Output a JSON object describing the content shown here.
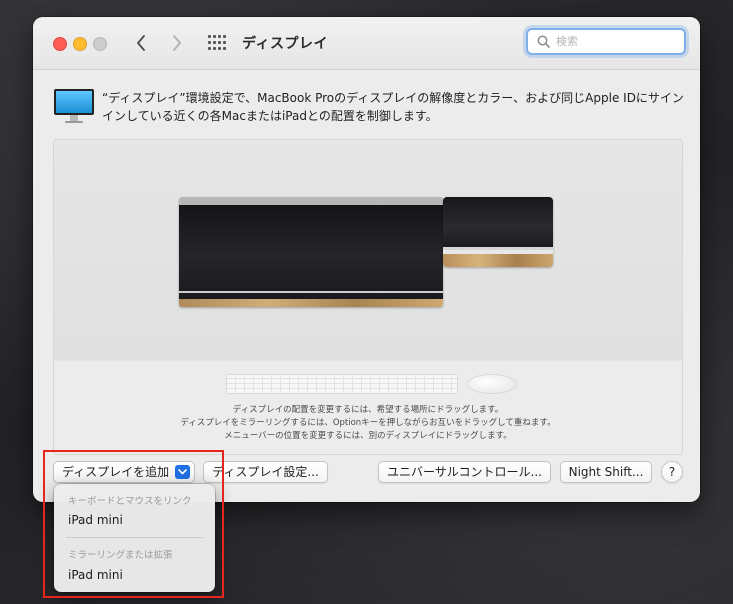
{
  "window": {
    "title": "ディスプレイ"
  },
  "search": {
    "placeholder": "検索"
  },
  "header": {
    "description": "“ディスプレイ”環境設定で、MacBook Proのディスプレイの解像度とカラー、および同じApple IDにサインインしている近くの各MacまたはiPadとの配置を制御します。"
  },
  "arrangement": {
    "hints": [
      "ディスプレイの配置を変更するには、希望する場所にドラッグします。",
      "ディスプレイをミラーリングするには、Optionキーを押しながらお互いをドラッグして重ねます。",
      "メニューバーの位置を変更するには、別のディスプレイにドラッグします。"
    ]
  },
  "buttons": {
    "add_display": "ディスプレイを追加",
    "display_settings": "ディスプレイ設定...",
    "universal_control": "ユニバーサルコントロール...",
    "night_shift": "Night Shift...",
    "help": "?"
  },
  "dropdown": {
    "sections": [
      {
        "header": "キーボードとマウスをリンク",
        "items": [
          "iPad mini"
        ]
      },
      {
        "header": "ミラーリングまたは拡張",
        "items": [
          "iPad mini"
        ]
      }
    ]
  },
  "colors": {
    "accent": "#1f6fe5",
    "annotation_highlight": "#e5261f",
    "search_focus_ring": "#7fb0ec"
  }
}
